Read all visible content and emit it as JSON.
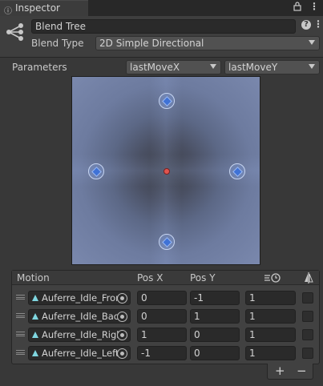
{
  "tab": {
    "title": "Inspector",
    "icon": "info-icon"
  },
  "toolbar_icons": [
    "lock-icon",
    "kebab-menu-icon"
  ],
  "header": {
    "icon": "blend-tree-icon",
    "name_value": "Blend Tree",
    "blend_type_label": "Blend Type",
    "blend_type_value": "2D Simple Directional",
    "help_icon": "help-icon",
    "settings_icon": "kebab-menu-icon"
  },
  "parameters": {
    "label": "Parameters",
    "x_param": "lastMoveX",
    "y_param": "lastMoveY"
  },
  "graph": {
    "points": [
      {
        "name": "Auferre_Idle_Front",
        "x": 0,
        "y": -1
      },
      {
        "name": "Auferre_Idle_Back",
        "x": 0,
        "y": 1
      },
      {
        "name": "Auferre_Idle_Right",
        "x": 1,
        "y": 0
      },
      {
        "name": "Auferre_Idle_Left",
        "x": -1,
        "y": 0
      }
    ],
    "center": {
      "x": 0,
      "y": 0
    }
  },
  "motion_table": {
    "headers": {
      "motion": "Motion",
      "pos_x": "Pos X",
      "pos_y": "Pos Y"
    },
    "header_icons": [
      "time-scale-icon",
      "mirror-icon"
    ],
    "rows": [
      {
        "motion": "Auferre_Idle_Fron",
        "pos_x": "0",
        "pos_y": "-1",
        "speed": "1",
        "mirror": false
      },
      {
        "motion": "Auferre_Idle_Bac",
        "pos_x": "0",
        "pos_y": "1",
        "speed": "1",
        "mirror": false
      },
      {
        "motion": "Auferre_Idle_Righ",
        "pos_x": "1",
        "pos_y": "0",
        "speed": "1",
        "mirror": false
      },
      {
        "motion": "Auferre_Idle_Left",
        "pos_x": "-1",
        "pos_y": "0",
        "speed": "1",
        "mirror": false
      }
    ],
    "add_label": "+",
    "remove_label": "−"
  }
}
